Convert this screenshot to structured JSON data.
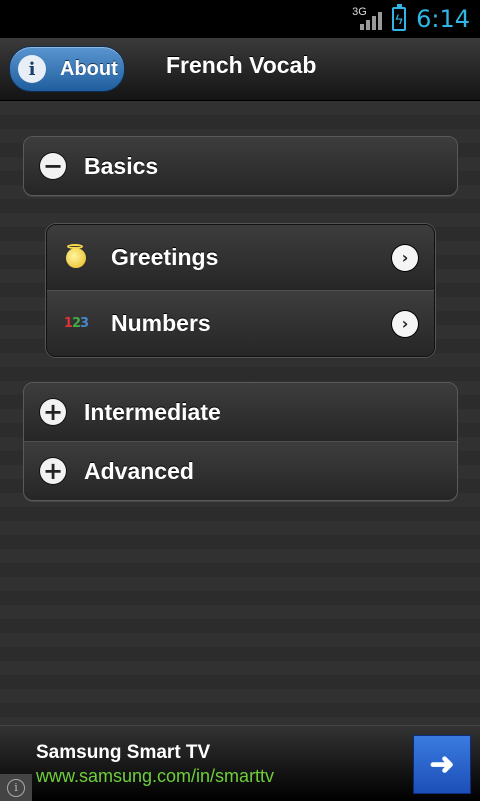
{
  "status_bar": {
    "network_type": "3G",
    "time": "6:14",
    "icons": [
      "signal-icon",
      "battery-charging-icon"
    ],
    "accent_color": "#2fb6e6"
  },
  "header": {
    "about_label": "About",
    "about_icon": "info-icon",
    "title": "French Vocab"
  },
  "sections": [
    {
      "label": "Basics",
      "state": "expanded",
      "toggle_icon": "minus-icon"
    },
    {
      "label": "Intermediate",
      "state": "collapsed",
      "toggle_icon": "plus-icon"
    },
    {
      "label": "Advanced",
      "state": "collapsed",
      "toggle_icon": "plus-icon"
    }
  ],
  "basics_items": [
    {
      "label": "Greetings",
      "icon": "smiley-halo-icon"
    },
    {
      "label": "Numbers",
      "icon": "numbers-123-icon",
      "icon_text": "123"
    }
  ],
  "ad": {
    "title": "Samsung Smart TV",
    "url": "www.samsung.com/in/smarttv",
    "url_color": "#6fcf3b",
    "info_icon": "info-icon",
    "go_icon": "arrow-right-icon"
  }
}
